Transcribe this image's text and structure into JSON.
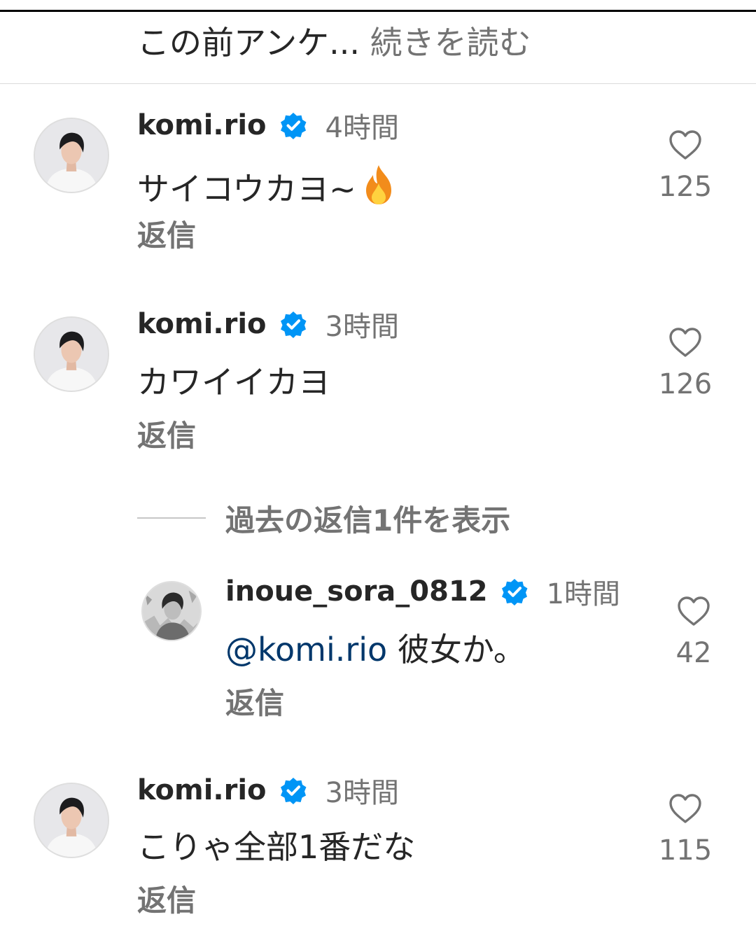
{
  "caption": {
    "text": "この前アンケ...",
    "more": "続きを読む"
  },
  "comments": [
    {
      "username": "komi.rio",
      "time": "4時間",
      "text": "サイコウカヨ~",
      "emoji": "fire-icon",
      "reply": "返信",
      "likes": "125"
    },
    {
      "username": "komi.rio",
      "time": "3時間",
      "text": "カワイイカヨ",
      "reply": "返信",
      "likes": "126"
    },
    {
      "username": "komi.rio",
      "time": "3時間",
      "text": "こりゃ全部1番だな",
      "reply": "返信",
      "likes": "115"
    }
  ],
  "view_replies": "過去の返信1件を表示",
  "nested_reply": {
    "username": "inoue_sora_0812",
    "time": "1時間",
    "mention": "@komi.rio",
    "text": " 彼女か。",
    "reply": "返信",
    "likes": "42"
  },
  "colors": {
    "verified": "#0095f6",
    "mention": "#00376b",
    "secondary": "#737373",
    "primary": "#262626"
  }
}
